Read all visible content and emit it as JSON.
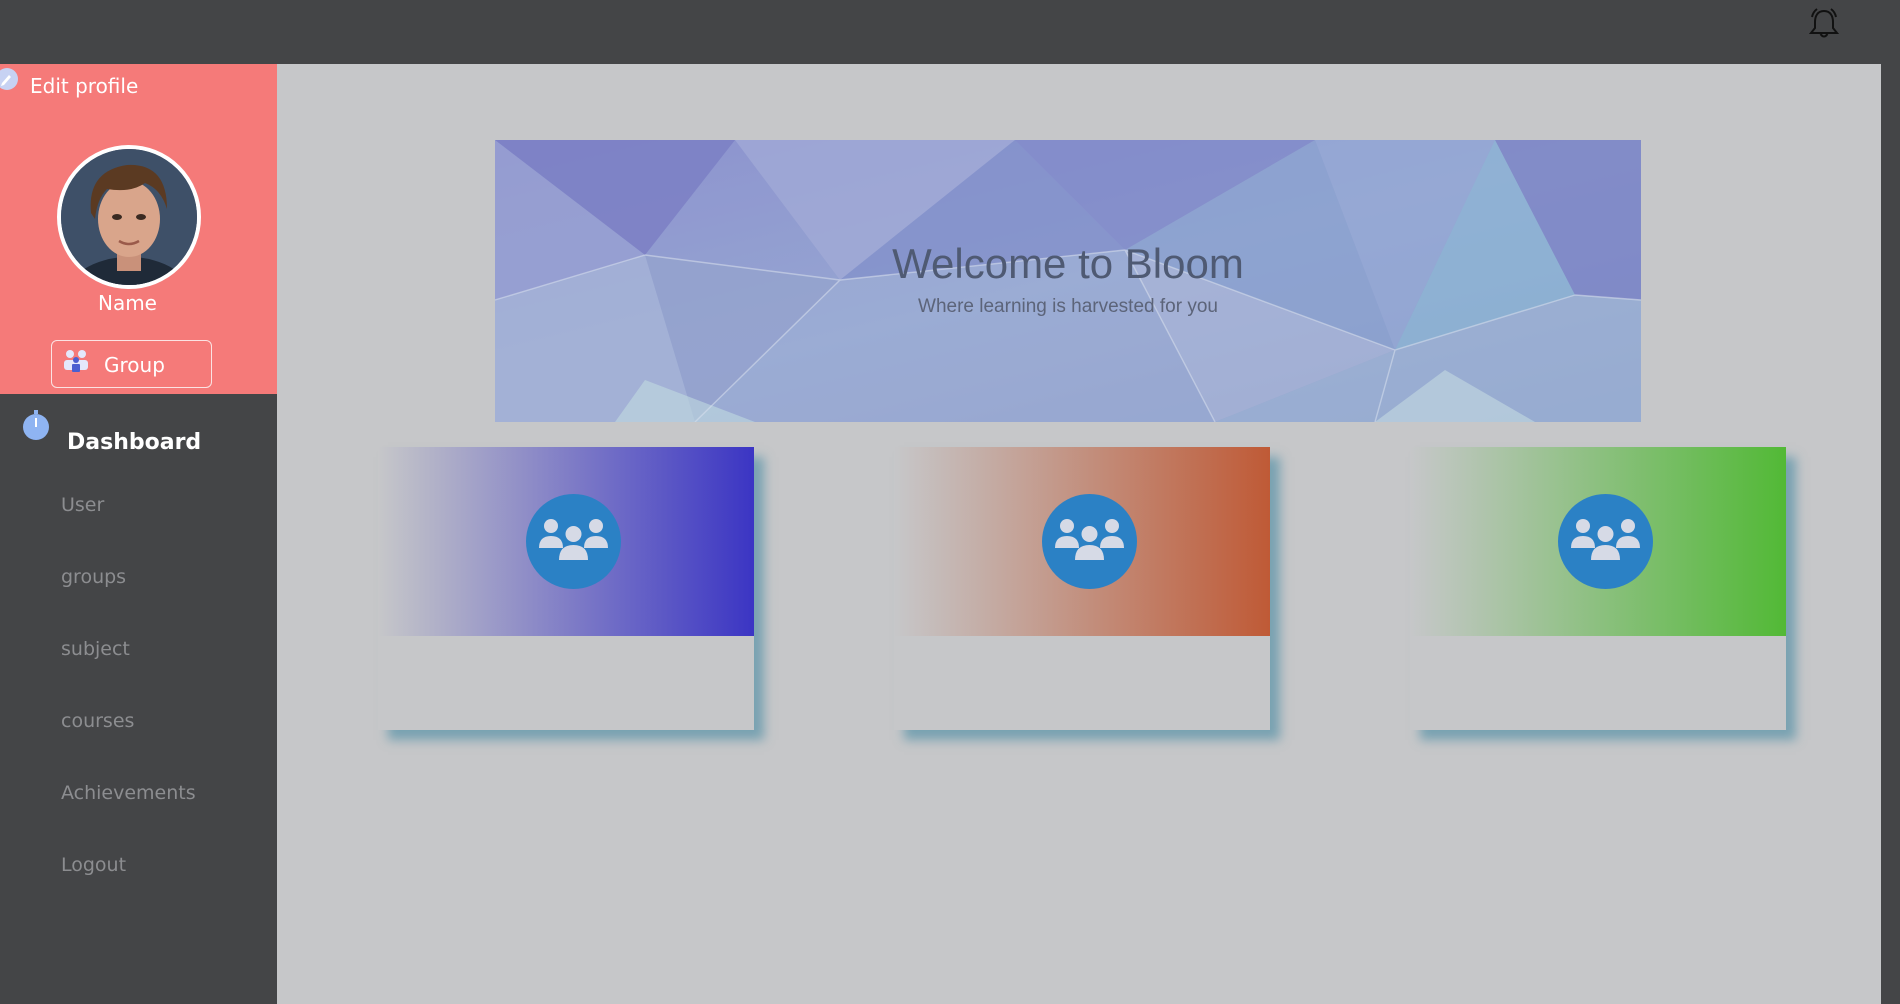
{
  "topbar": {
    "notification_icon": "bell-icon"
  },
  "sidebar": {
    "edit_profile": "Edit profile",
    "user_name": "Name",
    "group_button": "Group",
    "dashboard": "Dashboard",
    "items": [
      {
        "label": "User"
      },
      {
        "label": "groups"
      },
      {
        "label": "subject"
      },
      {
        "label": "courses"
      },
      {
        "label": "Achievements"
      },
      {
        "label": "Logout"
      }
    ],
    "colors": {
      "profile_bg": "#f57a79",
      "sidebar_bg": "#444547",
      "nav_text": "#8c8d90"
    }
  },
  "banner": {
    "title": "Welcome to Bloom",
    "subtitle": "Where learning is harvested for you"
  },
  "cards": [
    {
      "icon": "group-icon",
      "gradient_end": "#3b35c4"
    },
    {
      "icon": "group-icon",
      "gradient_end": "#bf5a36"
    },
    {
      "icon": "group-icon",
      "gradient_end": "#52b936"
    }
  ],
  "colors": {
    "main_bg": "#c6c7c9",
    "icon_circle": "#2b81c5"
  }
}
